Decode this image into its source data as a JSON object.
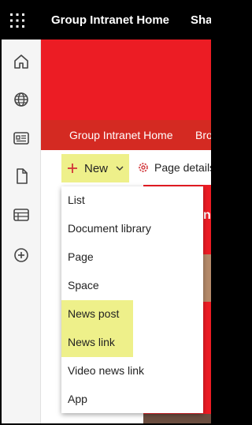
{
  "topbar": {
    "app_title": "Group Intranet Home",
    "share_label": "Sha"
  },
  "left_rail": {
    "items": [
      {
        "icon": "home-icon"
      },
      {
        "icon": "globe-icon"
      },
      {
        "icon": "news-icon"
      },
      {
        "icon": "document-icon"
      },
      {
        "icon": "list-icon"
      },
      {
        "icon": "add-icon"
      }
    ]
  },
  "site_nav": {
    "items": [
      "Group Intranet Home",
      "Bro"
    ]
  },
  "command_bar": {
    "new_label": "New",
    "page_details_label": "Page details"
  },
  "new_menu": {
    "items": [
      "List",
      "Document library",
      "Page",
      "Space",
      "News post",
      "News link",
      "Video news link",
      "App"
    ],
    "highlighted": [
      "News post",
      "News link"
    ]
  },
  "hero_text": "n",
  "colors": {
    "brand_red": "#ec1c24",
    "nav_red": "#d42a22",
    "highlight": "#eef08a",
    "accent": "#d13438"
  }
}
